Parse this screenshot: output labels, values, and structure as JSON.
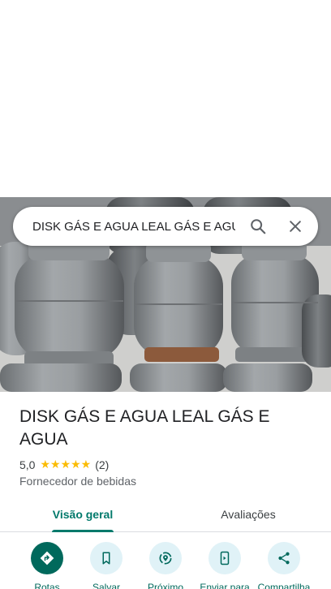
{
  "search": {
    "query": "DISK GÁS E AGUA LEAL GÁS E AGUA"
  },
  "place": {
    "name": "DISK GÁS E AGUA LEAL GÁS E AGUA",
    "rating": "5,0",
    "stars": "★★★★★",
    "review_count": "(2)",
    "category": "Fornecedor de bebidas"
  },
  "tabs": [
    {
      "label": "Visão geral",
      "active": true
    },
    {
      "label": "Avaliações",
      "active": false
    }
  ],
  "actions": [
    {
      "label": "Rotas",
      "icon": "directions-icon"
    },
    {
      "label": "Salvar",
      "icon": "bookmark-icon"
    },
    {
      "label": "Próximo",
      "icon": "nearby-icon"
    },
    {
      "label": "Enviar para",
      "icon": "send-to-phone-icon"
    },
    {
      "label": "Compartilha",
      "icon": "share-icon"
    }
  ],
  "colors": {
    "accent": "#00796b",
    "star": "#fbbc04",
    "action_bg": "#e0f2f7"
  }
}
